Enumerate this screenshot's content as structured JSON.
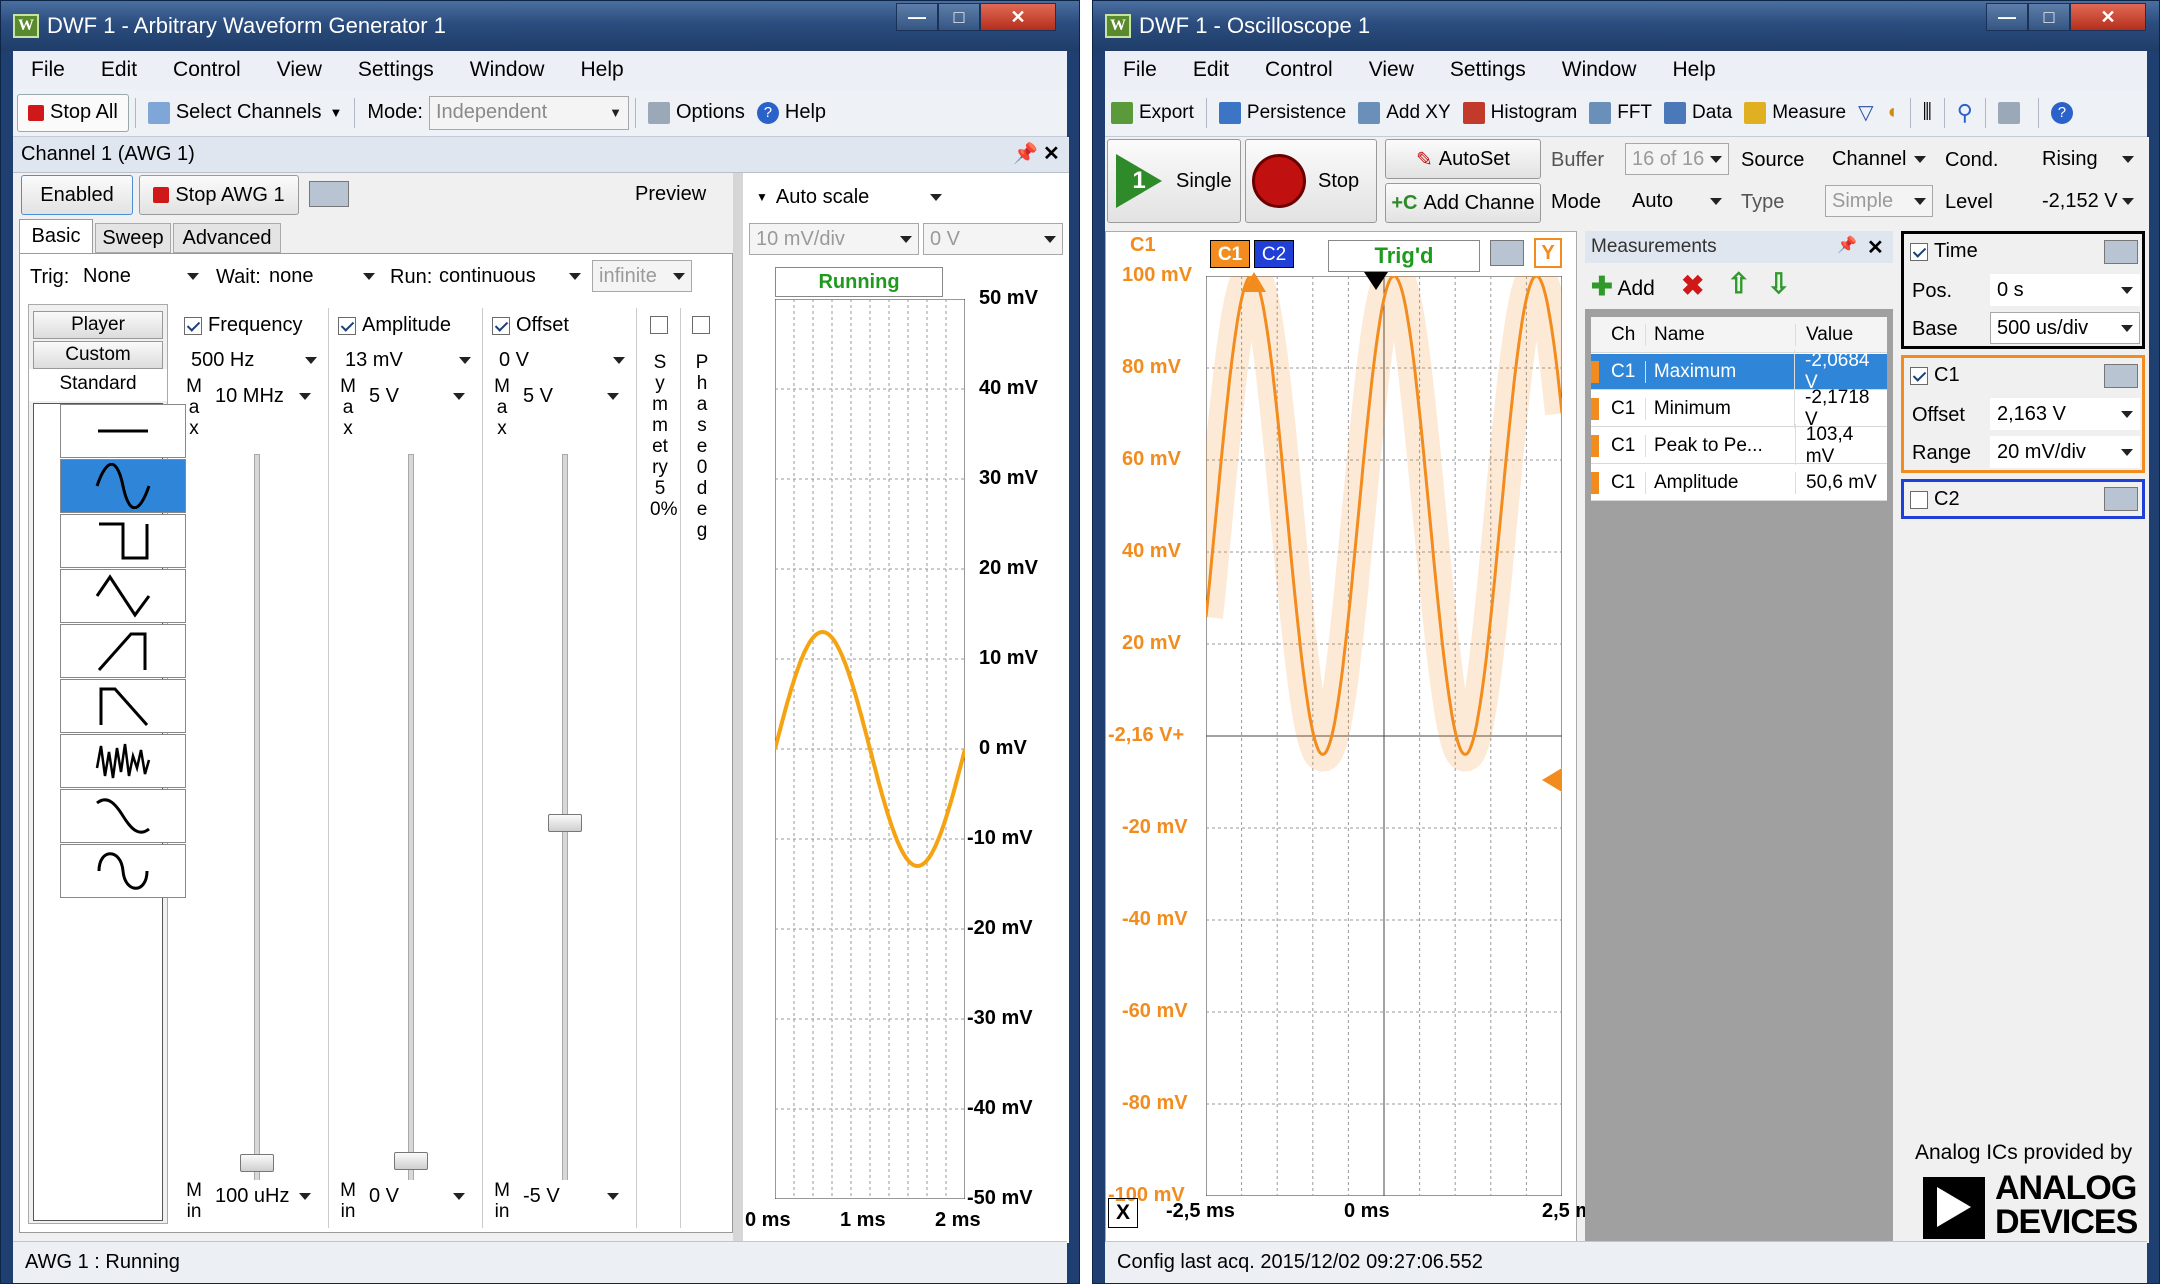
{
  "awg": {
    "title": "DWF 1 - Arbitrary Waveform Generator 1",
    "menu": [
      "File",
      "Edit",
      "Control",
      "View",
      "Settings",
      "Window",
      "Help"
    ],
    "toolbar": {
      "stop_all": "Stop All",
      "select_channels": "Select Channels",
      "mode_label": "Mode:",
      "mode_value": "Independent",
      "options": "Options",
      "help": "Help"
    },
    "channel_header": "Channel 1 (AWG 1)",
    "enabled_btn": "Enabled",
    "stop_awg_btn": "Stop AWG 1",
    "preview_label": "Preview",
    "tabs": [
      "Basic",
      "Sweep",
      "Advanced"
    ],
    "trig_label": "Trig:",
    "trig_value": "None",
    "wait_label": "Wait:",
    "wait_value": "none",
    "run_label": "Run:",
    "run_value": "continuous",
    "run_count": "infinite",
    "side_tabs": [
      "Player",
      "Custom",
      "Standard"
    ],
    "frequency": {
      "label": "Frequency",
      "value": "500 Hz",
      "max": "10 MHz",
      "min": "100 uHz",
      "max_label": "Max",
      "min_label": "Min"
    },
    "amplitude": {
      "label": "Amplitude",
      "value": "13 mV",
      "max": "5 V",
      "min": "0 V",
      "max_label": "Max",
      "min_label": "Min"
    },
    "offset": {
      "label": "Offset",
      "value": "0 V",
      "max": "5 V",
      "min": "-5 V",
      "max_label": "Max",
      "min_label": "Min"
    },
    "symmetry_text": "Symmetry 50%",
    "phase_text": "Phase 0deg",
    "preview": {
      "scale_mode": "Auto scale",
      "div": "10 mV/div",
      "offset": "0 V",
      "status": "Running",
      "y_ticks": [
        "50 mV",
        "40 mV",
        "30 mV",
        "20 mV",
        "10 mV",
        "0 mV",
        "-10 mV",
        "-20 mV",
        "-30 mV",
        "-40 mV",
        "-50 mV"
      ],
      "x_ticks": [
        "0 ms",
        "1 ms",
        "2 ms"
      ],
      "wave_color": "#f5a312"
    },
    "status": "AWG 1 : Running"
  },
  "scope": {
    "title": "DWF 1 - Oscilloscope 1",
    "menu": [
      "File",
      "Edit",
      "Control",
      "View",
      "Settings",
      "Window",
      "Help"
    ],
    "toolbar": [
      "Export",
      "Persistence",
      "Add XY",
      "Histogram",
      "FFT",
      "Data",
      "Measure"
    ],
    "single_btn": "Single",
    "stop_btn": "Stop",
    "autoset_btn": "AutoSet",
    "add_channel_btn": "Add Channe",
    "buffer_label": "Buffer",
    "buffer_value": "16 of 16",
    "mode_label": "Mode",
    "mode_value": "Auto",
    "source_label": "Source",
    "source_value": "Channel",
    "type_label": "Type",
    "type_value": "Simple",
    "cond_label": "Cond.",
    "cond_value": "Rising",
    "level_label": "Level",
    "level_value": "-2,152 V",
    "plot": {
      "c1_label": "C1",
      "c1_tag": "C1",
      "c2_tag": "C2",
      "trig_status": "Trig'd",
      "y_badge": "Y",
      "y_ticks": [
        "100 mV",
        "80 mV",
        "60 mV",
        "40 mV",
        "20 mV",
        "-2,16 V+",
        "-20 mV",
        "-40 mV",
        "-60 mV",
        "-80 mV",
        "-100 mV"
      ],
      "x_ticks": [
        "-2,5 ms",
        "0 ms",
        "2,5 m"
      ],
      "x_btn": "X",
      "trace_color": "#f28c1e"
    },
    "measurements": {
      "title": "Measurements",
      "add": "Add",
      "col_ch": "Ch",
      "col_name": "Name",
      "col_value": "Value",
      "rows": [
        {
          "ch": "C1",
          "name": "Maximum",
          "value": "-2,0684 V"
        },
        {
          "ch": "C1",
          "name": "Minimum",
          "value": "-2,1718 V"
        },
        {
          "ch": "C1",
          "name": "Peak to Pe...",
          "value": "103,4 mV"
        },
        {
          "ch": "C1",
          "name": "Amplitude",
          "value": "50,6 mV"
        }
      ]
    },
    "time": {
      "label": "Time",
      "pos_label": "Pos.",
      "pos_value": "0 s",
      "base_label": "Base",
      "base_value": "500 us/div"
    },
    "c1": {
      "label": "C1",
      "offset_label": "Offset",
      "offset_value": "2,163 V",
      "range_label": "Range",
      "range_value": "20 mV/div",
      "color": "#f28c1e"
    },
    "c2": {
      "label": "C2",
      "color": "#1f3fd6"
    },
    "brand_line": "Analog ICs provided by",
    "brand_name1": "ANALOG",
    "brand_name2": "DEVICES",
    "status": "Config last acq. 2015/12/02  09:27:06.552"
  }
}
